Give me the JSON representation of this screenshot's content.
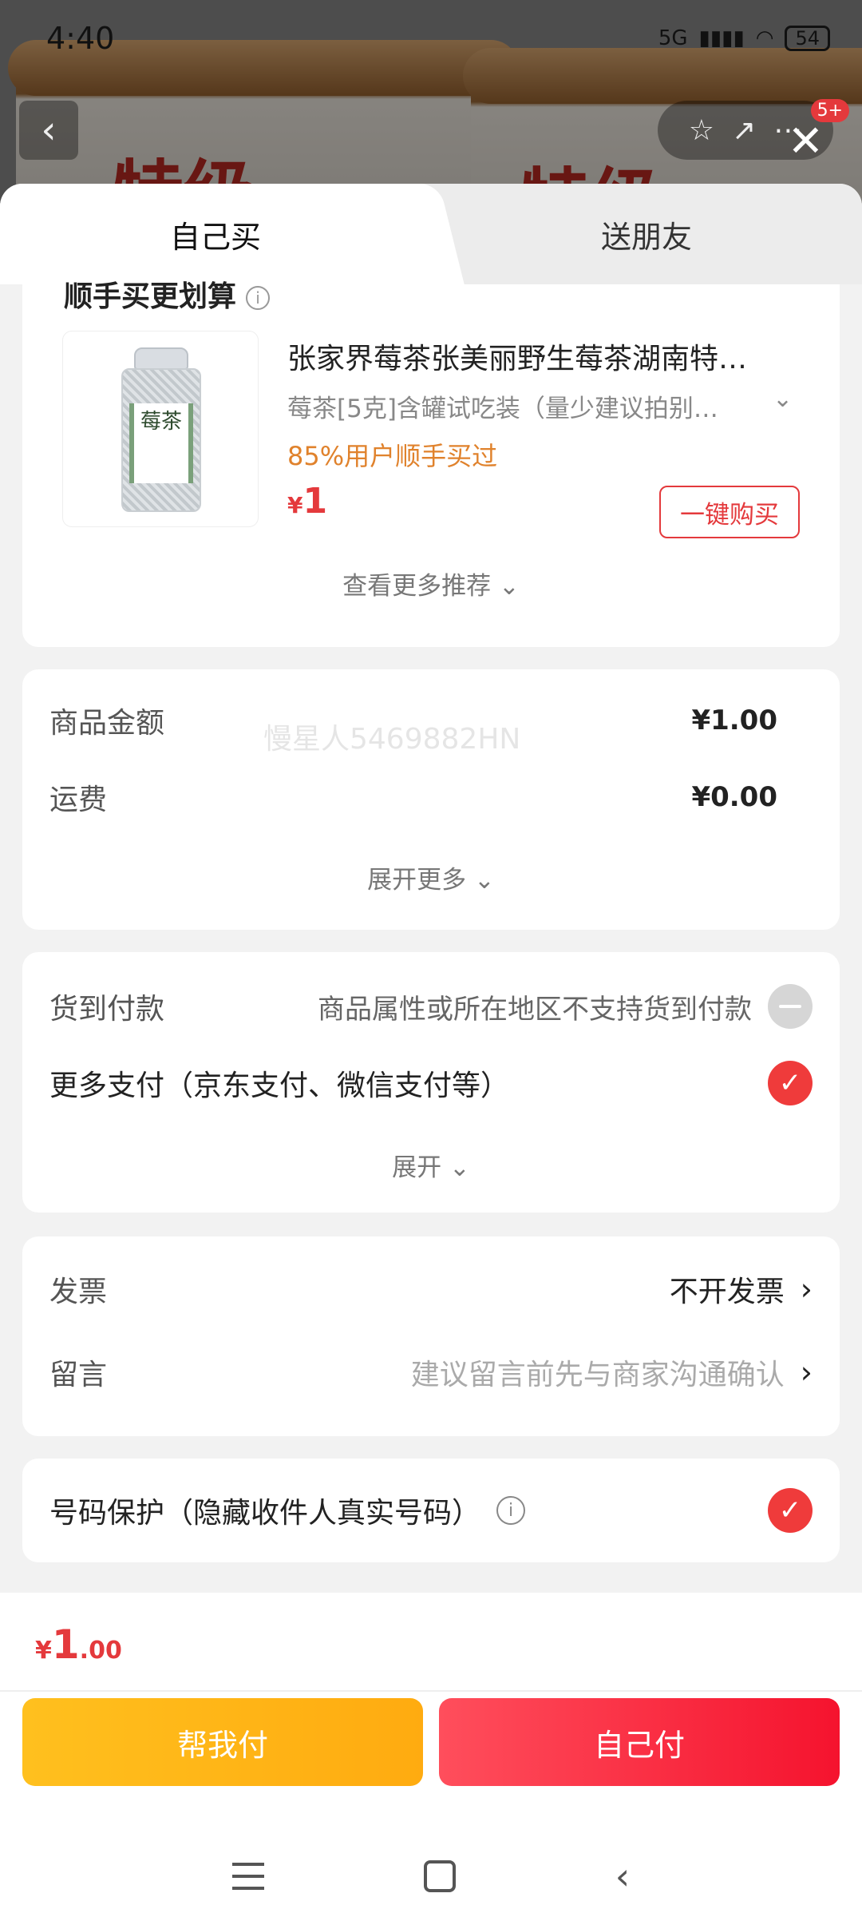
{
  "status_bar": {
    "time": "4:40",
    "network": "5G",
    "battery": "54"
  },
  "hero": {
    "glyph_left": "特级",
    "glyph_right": "特级"
  },
  "header": {
    "badge": "5+"
  },
  "tabs": {
    "self": "自己买",
    "gift": "送朋友"
  },
  "recommend": {
    "heading": "顺手买更划算",
    "product_title": "张家界莓茶张美丽野生莓茶湖南特…",
    "spec": "莓茶[5克]含罐试吃装（量少建议拍别…",
    "stat": "85%用户顺手买过",
    "price_symbol": "¥",
    "price": "1",
    "buy_label": "一键购买",
    "more_label": "查看更多推荐 ⌄",
    "jar_label": "莓茶"
  },
  "pricing": {
    "goods_label": "商品金额",
    "goods_value": "¥1.00",
    "shipping_label": "运费",
    "shipping_value": "¥0.00",
    "expand_label": "展开更多 ⌄"
  },
  "watermark": "慢星人5469882HN",
  "payment": {
    "cod_label": "货到付款",
    "cod_note": "商品属性或所在地区不支持货到付款",
    "more_label": "更多支付（京东支付、微信支付等）",
    "expand_label": "展开 ⌄"
  },
  "invoice": {
    "invoice_label": "发票",
    "invoice_value": "不开发票",
    "message_label": "留言",
    "message_placeholder": "建议留言前先与商家沟通确认"
  },
  "protection": {
    "label": "号码保护（隐藏收件人真实号码）"
  },
  "footer": {
    "total_symbol": "¥",
    "total_int": "1",
    "total_dec": ".00",
    "help_pay": "帮我付",
    "self_pay": "自己付"
  }
}
